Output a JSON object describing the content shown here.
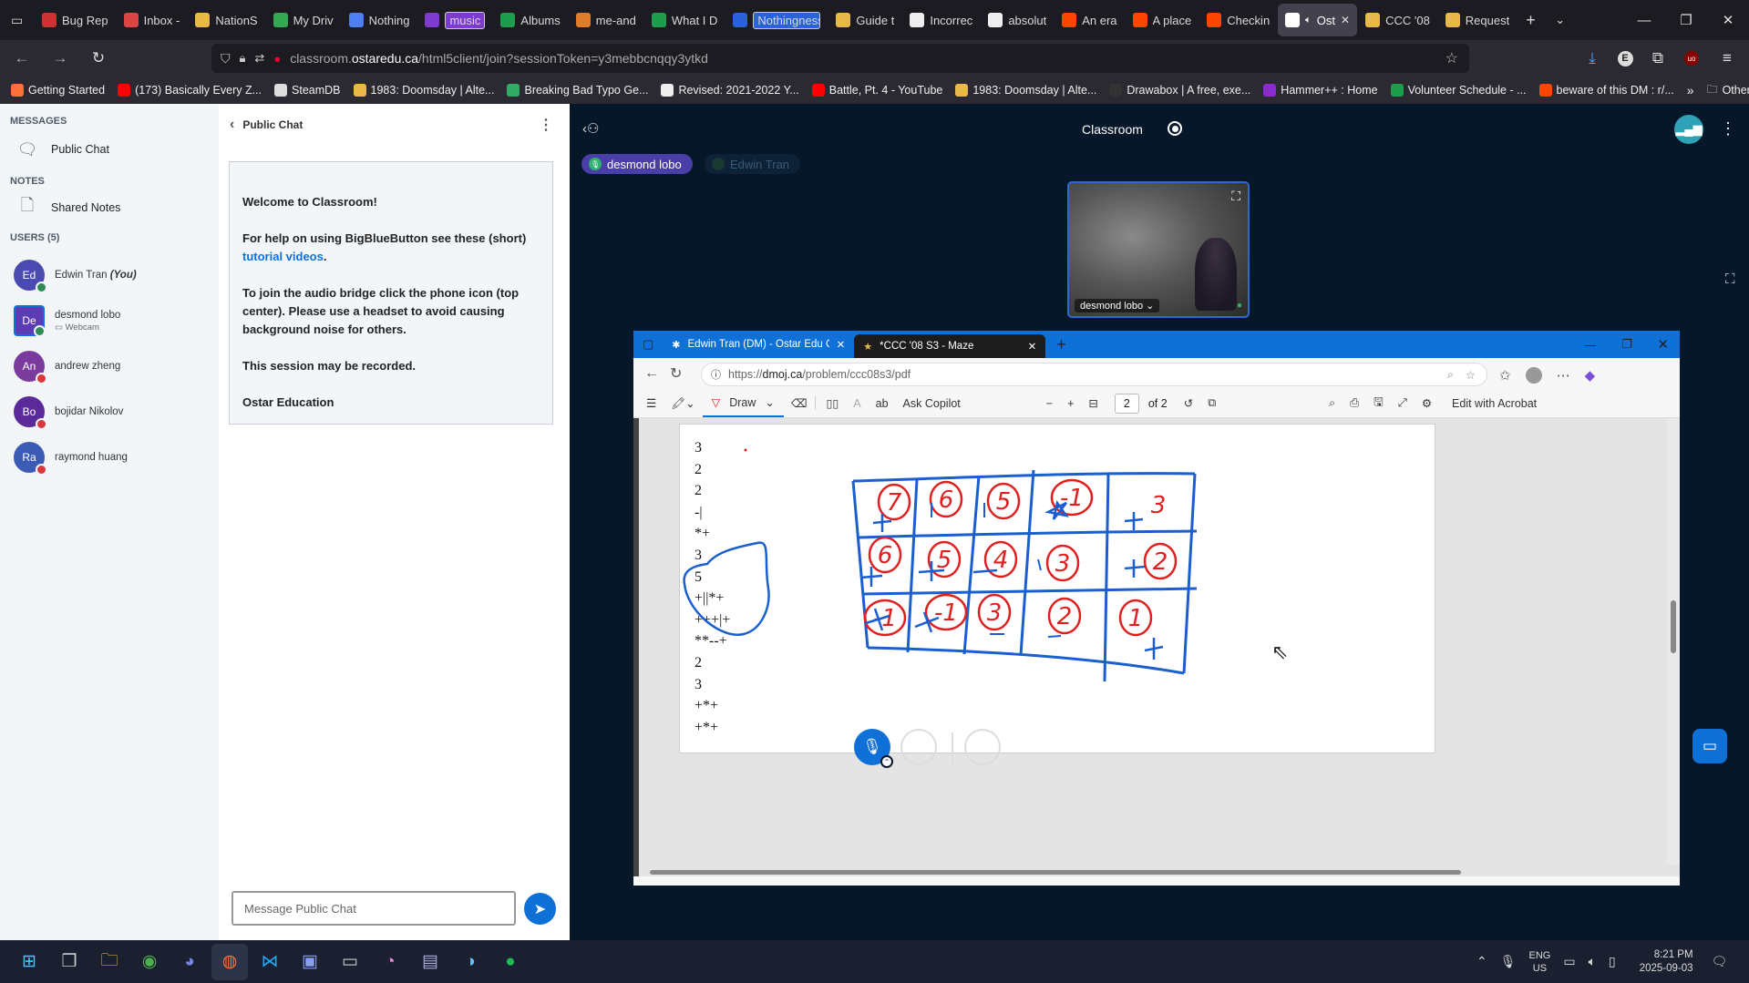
{
  "browser": {
    "tabs": [
      {
        "label": "Bug Rep",
        "fav": "#c33"
      },
      {
        "label": "Inbox -",
        "fav": "#d44"
      },
      {
        "label": "NationS",
        "fav": "#e8b84a"
      },
      {
        "label": "My Driv",
        "fav": "#34a853"
      },
      {
        "label": "Nothing",
        "fav": "#4f7ff0"
      },
      {
        "label": "music",
        "fav": "#7e3bd0",
        "badge": true
      },
      {
        "label": "Albums",
        "fav": "#1e9e4c"
      },
      {
        "label": "me-and",
        "fav": "#e07c2a"
      },
      {
        "label": "What I D",
        "fav": "#1e9e4c"
      },
      {
        "label": "Nothingness",
        "fav": "#2a62d9",
        "badge": true
      },
      {
        "label": "Guide t",
        "fav": "#e8b84a"
      },
      {
        "label": "Incorrec",
        "fav": "#eee"
      },
      {
        "label": "absolut",
        "fav": "#eee"
      },
      {
        "label": "An era",
        "fav": "#ff4500"
      },
      {
        "label": "A place",
        "fav": "#ff4500"
      },
      {
        "label": "Checkin",
        "fav": "#ff4500"
      },
      {
        "label": "Ost",
        "fav": "#fff",
        "active": true
      },
      {
        "label": "CCC '08",
        "fav": "#e8b84a"
      },
      {
        "label": "Request",
        "fav": "#e8b84a"
      }
    ],
    "url_prefix": "classroom.",
    "url_domain": "ostaredu.ca",
    "url_path": "/html5client/join?sessionToken=y3mebbcnqqy3ytkd",
    "bookmarks": [
      {
        "label": "Getting Started",
        "fav": "#ff7139"
      },
      {
        "label": "(173) Basically Every Z...",
        "fav": "#f00"
      },
      {
        "label": "SteamDB",
        "fav": "#ddd"
      },
      {
        "label": "1983: Doomsday | Alte...",
        "fav": "#e8b84a"
      },
      {
        "label": "Breaking Bad Typo Ge...",
        "fav": "#3a6"
      },
      {
        "label": "Revised: 2021-2022 Y...",
        "fav": "#eee"
      },
      {
        "label": "Battle, Pt. 4 - YouTube",
        "fav": "#f00"
      },
      {
        "label": "1983: Doomsday | Alte...",
        "fav": "#e8b84a"
      },
      {
        "label": "Drawabox | A free, exe...",
        "fav": "#333"
      },
      {
        "label": "Hammer++ : Home",
        "fav": "#8a2bd0"
      },
      {
        "label": "Volunteer Schedule - ...",
        "fav": "#1e9e4c"
      },
      {
        "label": "beware of this DM : r/...",
        "fav": "#ff4500"
      }
    ],
    "other_bookmarks": "Other Bookmarks"
  },
  "sidebar": {
    "messages_heading": "MESSAGES",
    "public_chat": "Public Chat",
    "notes_heading": "NOTES",
    "shared_notes": "Shared Notes",
    "users_heading": "USERS (5)",
    "users": [
      {
        "initials": "Ed",
        "name": "Edwin Tran",
        "you": "(You)",
        "color": "#4a4ab0",
        "status": "#2e8b57"
      },
      {
        "initials": "De",
        "name": "desmond lobo",
        "sub": "Webcam",
        "color": "#5d3bb5",
        "status": "#2e8b57"
      },
      {
        "initials": "An",
        "name": "andrew zheng",
        "color": "#7a3b9d",
        "status": "#d9363e"
      },
      {
        "initials": "Bo",
        "name": "bojidar Nikolov",
        "color": "#5a2a9a",
        "status": "#d9363e"
      },
      {
        "initials": "Ra",
        "name": "raymond huang",
        "color": "#3b5bb5",
        "status": "#d9363e"
      }
    ]
  },
  "chat": {
    "title": "Public Chat",
    "welcome": "Welcome to Classroom!",
    "help_text": "For help on using BigBlueButton see these (short)",
    "help_link": "tutorial videos",
    "audio_text": "To join the audio bridge click the phone icon (top center). Please use a headset to avoid causing background noise for others.",
    "recorded": "This session may be recorded.",
    "signature": "Ostar Education",
    "placeholder": "Message Public Chat"
  },
  "meeting": {
    "title": "Classroom",
    "talker_active": "desmond lobo",
    "talker_inactive": "Edwin Tran",
    "cam_name": "desmond lobo"
  },
  "screenshare": {
    "tab1": "Edwin Tran (DM) - Ostar Edu CCC",
    "tab2": "*CCC '08 S3 - Maze",
    "url_prefix": "https://",
    "url_domain": "dmoj.ca",
    "url_path": "/problem/ccc08s3/pdf",
    "draw": "Draw",
    "copilot": "Ask Copilot",
    "page_num": "2",
    "page_of": "of 2",
    "acrobat": "Edit with Acrobat",
    "pdf_lines": [
      "3",
      "2",
      "2",
      "-|",
      "*+",
      "3",
      "5",
      "+||*+",
      "+++|+",
      "**--+",
      "2",
      "3",
      "+*+",
      "+*+"
    ],
    "grid_numbers": [
      [
        "7",
        "6",
        "5",
        "-1",
        "3"
      ],
      [
        "6",
        "5",
        "4",
        "3",
        "2"
      ],
      [
        "-1",
        "-1",
        "3",
        "2",
        "1"
      ]
    ]
  },
  "taskbar": {
    "lang": "ENG",
    "region": "US",
    "time": "8:21 PM",
    "date": "2025-09-03"
  },
  "colors": {
    "bbb_blue": "#0f70d7",
    "ink_red": "#e02020",
    "ink_blue": "#1a5fd0",
    "meeting_bg": "#06172a"
  }
}
